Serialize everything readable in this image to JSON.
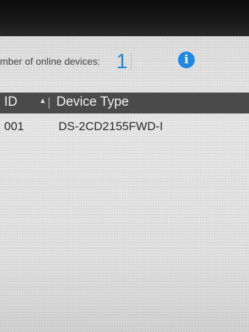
{
  "online_devices": {
    "label": "mber of online devices:",
    "count": "1",
    "info_icon": "info-icon"
  },
  "table": {
    "columns": [
      "ID",
      "Device Type"
    ],
    "sort_indicator": "▲",
    "rows": [
      {
        "id": "001",
        "device_type": "DS-2CD2155FWD-I"
      }
    ]
  },
  "colors": {
    "accent": "#1e88e5",
    "header_bg": "#4a4a4a"
  }
}
